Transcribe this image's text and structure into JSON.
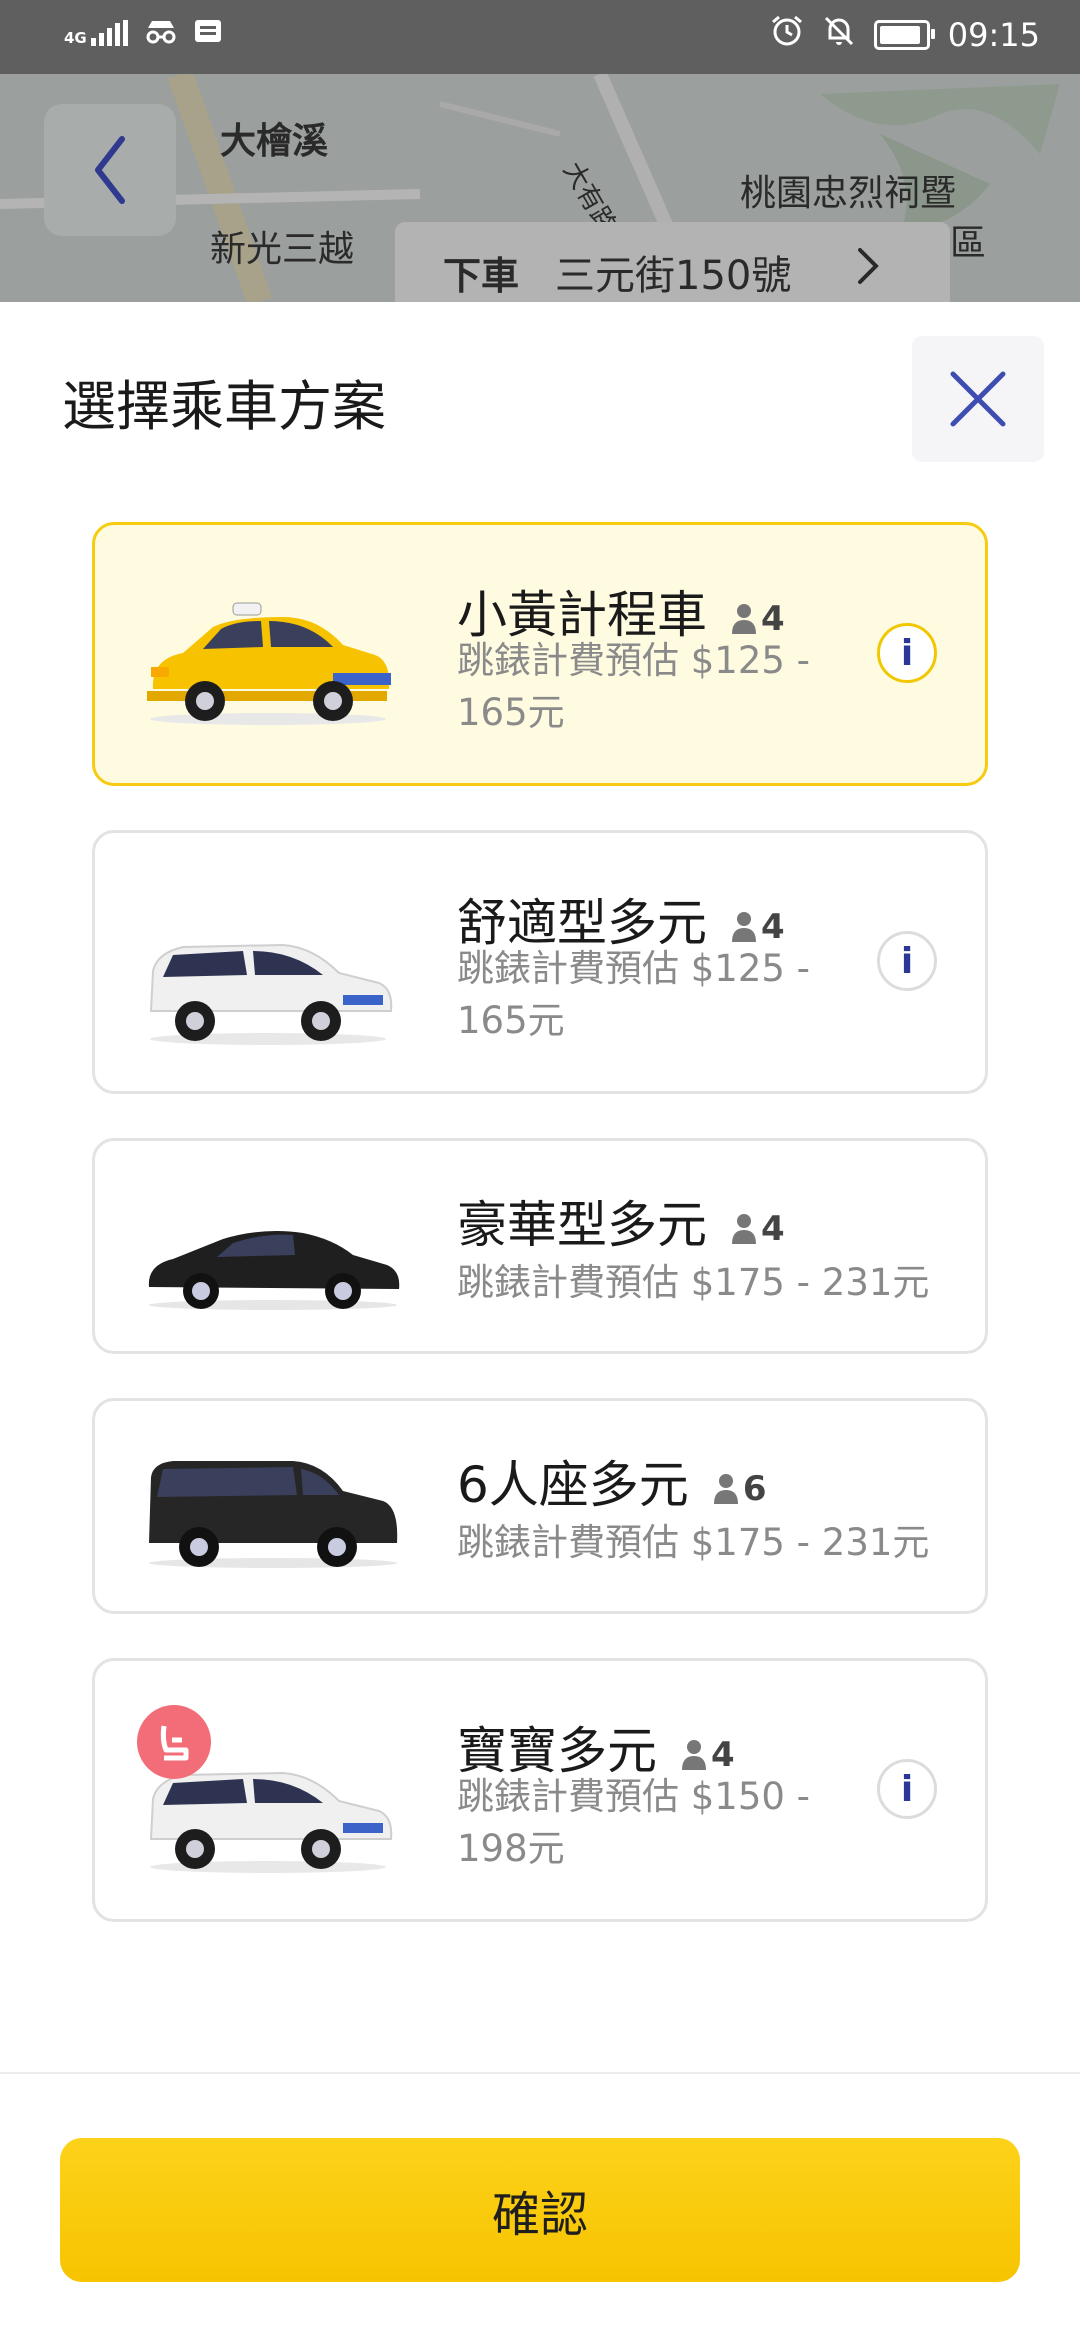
{
  "status_bar": {
    "network": "4G",
    "time": "09:15",
    "icons": [
      "signal-icon",
      "incognito-icon",
      "notification-icon",
      "alarm-icon",
      "mute-icon",
      "battery-icon"
    ]
  },
  "map": {
    "labels": [
      "大檜溪",
      "新光三越",
      "大有路",
      "桃園忠烈祠暨",
      "區"
    ],
    "destination_label": "下車",
    "destination_address": "三元街150號"
  },
  "sheet": {
    "title": "選擇乘車方案",
    "options": [
      {
        "name": "小黃計程車",
        "passengers": "4",
        "price": "跳錶計費預估 $125 - 165元",
        "car": "yellow-taxi",
        "selected": true,
        "info": "i"
      },
      {
        "name": "舒適型多元",
        "passengers": "4",
        "price": "跳錶計費預估 $125 - 165元",
        "car": "white-minivan",
        "selected": false,
        "info": "i"
      },
      {
        "name": "豪華型多元",
        "passengers": "4",
        "price": "跳錶計費預估 $175 - 231元",
        "car": "black-sedan",
        "selected": false
      },
      {
        "name": "6人座多元",
        "passengers": "6",
        "price": "跳錶計費預估 $175 - 231元",
        "car": "black-van",
        "selected": false
      },
      {
        "name": "寶寶多元",
        "passengers": "4",
        "price": "跳錶計費預估 $150 - 198元",
        "car": "white-minivan",
        "badge": "child-seat-icon",
        "selected": false,
        "info": "i"
      }
    ],
    "confirm_label": "確認"
  },
  "colors": {
    "accent": "#f7c400",
    "selected_bg": "#fffbe1",
    "info_icon": "#2c3896",
    "badge": "#f26d78"
  }
}
